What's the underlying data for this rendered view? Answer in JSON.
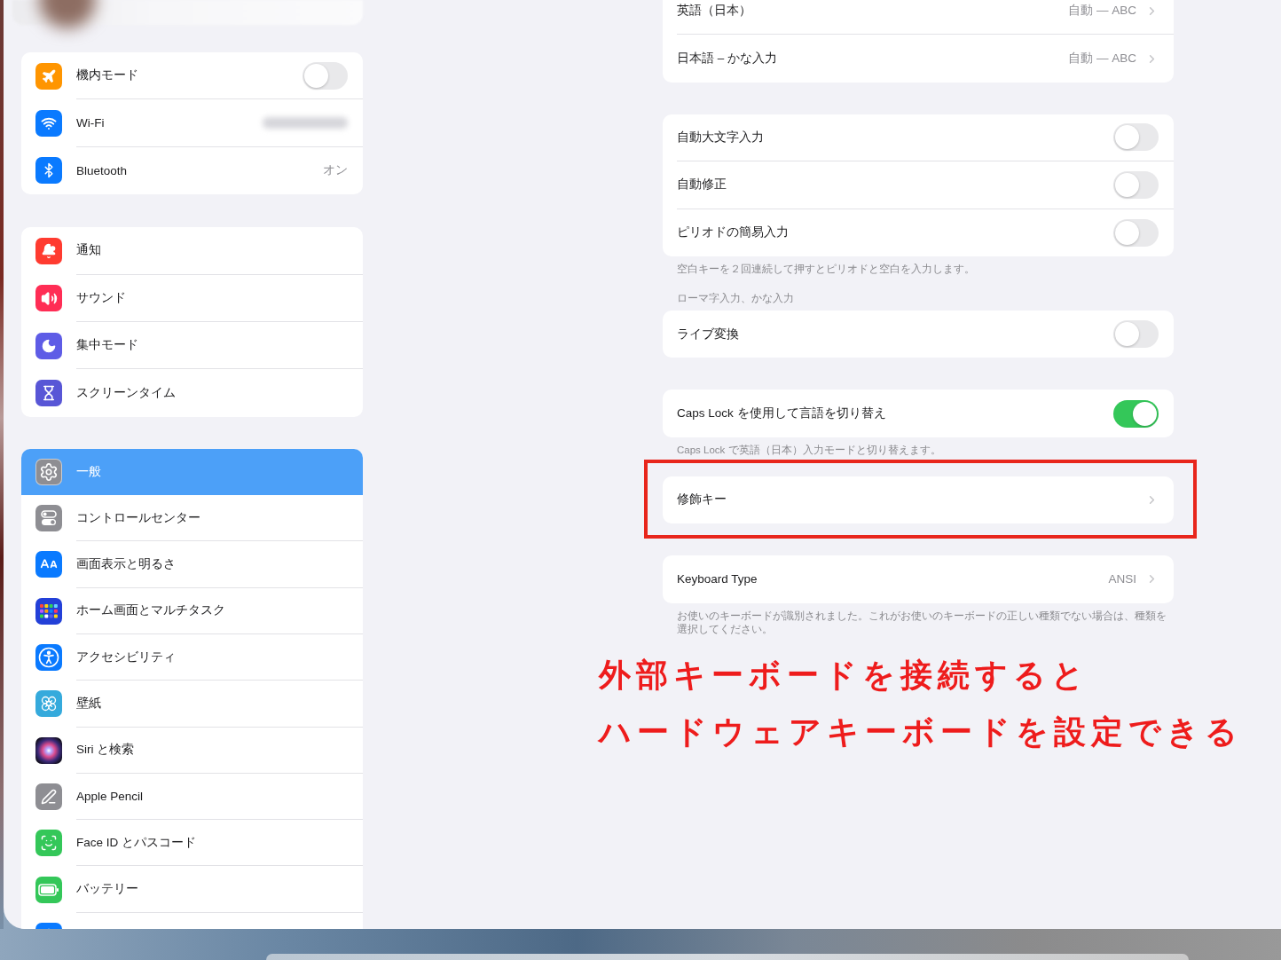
{
  "sidebar": {
    "groups": [
      {
        "items": [
          {
            "label": "機内モード",
            "kind": "toggle",
            "on": false,
            "selected": false
          },
          {
            "label": "Wi-Fi",
            "kind": "redacted",
            "selected": false
          },
          {
            "label": "Bluetooth",
            "kind": "value",
            "value": "オン",
            "selected": false
          }
        ]
      },
      {
        "items": [
          {
            "label": "通知",
            "kind": "plain",
            "selected": false
          },
          {
            "label": "サウンド",
            "kind": "plain",
            "selected": false
          },
          {
            "label": "集中モード",
            "kind": "plain",
            "selected": false
          },
          {
            "label": "スクリーンタイム",
            "kind": "plain",
            "selected": false
          }
        ]
      },
      {
        "items": [
          {
            "label": "一般",
            "kind": "plain",
            "selected": true
          },
          {
            "label": "コントロールセンター",
            "kind": "plain",
            "selected": false
          },
          {
            "label": "画面表示と明るさ",
            "kind": "plain",
            "selected": false
          },
          {
            "label": "ホーム画面とマルチタスク",
            "kind": "plain",
            "selected": false
          },
          {
            "label": "アクセシビリティ",
            "kind": "plain",
            "selected": false
          },
          {
            "label": "壁紙",
            "kind": "plain",
            "selected": false
          },
          {
            "label": "Siri と検索",
            "kind": "plain",
            "selected": false
          },
          {
            "label": "Apple Pencil",
            "kind": "plain",
            "selected": false
          },
          {
            "label": "Face ID とパスコード",
            "kind": "plain",
            "selected": false
          },
          {
            "label": "バッテリー",
            "kind": "plain",
            "selected": false
          },
          {
            "kind": "plain",
            "selected": false
          }
        ]
      }
    ]
  },
  "detail": {
    "groups": [
      {
        "highlighted": false,
        "rows": [
          {
            "label": "英語（日本）",
            "kind": "link",
            "value": "自動 — ABC"
          },
          {
            "label": "日本語 – かな入力",
            "kind": "link",
            "value": "自動 — ABC"
          }
        ]
      },
      {
        "highlighted": false,
        "rows": [
          {
            "label": "自動大文字入力",
            "kind": "toggle",
            "on": false
          },
          {
            "label": "自動修正",
            "kind": "toggle",
            "on": false
          },
          {
            "label": "ピリオドの簡易入力",
            "kind": "toggle",
            "on": false
          }
        ],
        "footer": "空白キーを２回連続して押すとピリオドと空白を入力します。"
      },
      {
        "highlighted": false,
        "header": "ローマ字入力、かな入力",
        "rows": [
          {
            "label": "ライブ変換",
            "kind": "toggle",
            "on": false
          }
        ]
      },
      {
        "highlighted": false,
        "rows": [
          {
            "label": "Caps Lock を使用して言語を切り替え",
            "kind": "toggle",
            "on": true
          }
        ],
        "footer": "Caps Lock で英語（日本）入力モードと切り替えます。"
      },
      {
        "highlighted": true,
        "rows": [
          {
            "label": "修飾キー",
            "kind": "link"
          }
        ]
      },
      {
        "highlighted": false,
        "rows": [
          {
            "label": "Keyboard Type",
            "kind": "link",
            "value": "ANSI"
          }
        ],
        "footer": "お使いのキーボードが識別されました。これがお使いのキーボードの正しい種類でない場合は、種類を選択してください。"
      }
    ]
  },
  "annotation": {
    "lines": [
      "外部キーボードを接続すると",
      "ハードウェアキーボードを設定できる"
    ]
  }
}
